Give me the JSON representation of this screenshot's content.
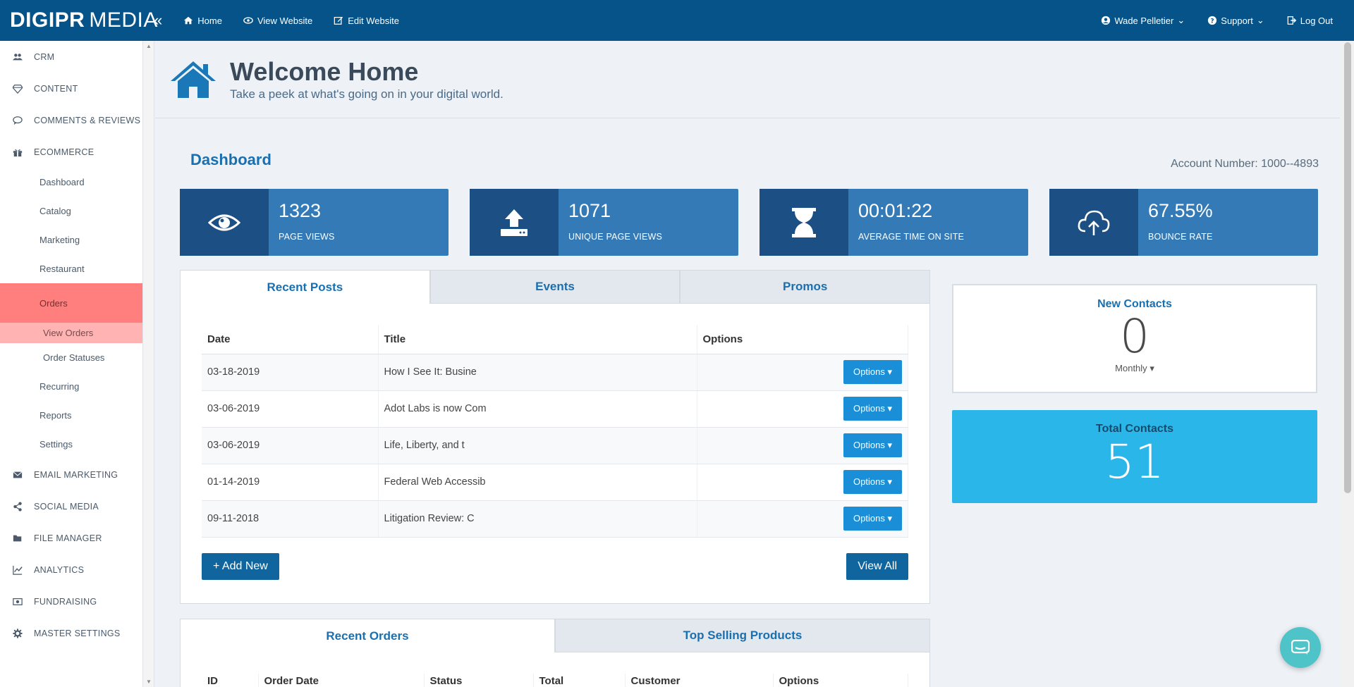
{
  "brand": {
    "part1": "DIGIPR",
    "part2": "MEDIA"
  },
  "topnav": [
    {
      "label": "Home"
    },
    {
      "label": "View Website"
    },
    {
      "label": "Edit Website"
    }
  ],
  "topright": {
    "user": "Wade Pelletier",
    "support": "Support",
    "logout": "Log Out"
  },
  "sidebar": {
    "crm": "CRM",
    "content": "CONTENT",
    "comments": "COMMENTS & REVIEWS",
    "ecommerce": "ECOMMERCE",
    "ecom_sub": [
      "Dashboard",
      "Catalog",
      "Marketing",
      "Restaurant"
    ],
    "orders": "Orders",
    "view_orders": "View Orders",
    "order_statuses": "Order Statuses",
    "ecom_sub2": [
      "Recurring",
      "Reports",
      "Settings"
    ],
    "email": "EMAIL MARKETING",
    "social": "SOCIAL MEDIA",
    "files": "FILE MANAGER",
    "analytics": "ANALYTICS",
    "fundraising": "FUNDRAISING",
    "master": "MASTER SETTINGS"
  },
  "hero": {
    "title": "Welcome Home",
    "subtitle": "Take a peek at what's going on in your digital world."
  },
  "dashboard": {
    "title": "Dashboard",
    "account": "Account Number: 1000--4893"
  },
  "stats": [
    {
      "value": "1323",
      "label": "PAGE VIEWS"
    },
    {
      "value": "1071",
      "label": "UNIQUE PAGE VIEWS"
    },
    {
      "value": "00:01:22",
      "label": "AVERAGE TIME ON SITE"
    },
    {
      "value": "67.55%",
      "label": "BOUNCE RATE"
    }
  ],
  "posts": {
    "tabs": [
      "Recent Posts",
      "Events",
      "Promos"
    ],
    "headers": [
      "Date",
      "Title",
      "Options"
    ],
    "rows": [
      {
        "date": "03-18-2019",
        "title": "How I See It: Busine"
      },
      {
        "date": "03-06-2019",
        "title": "Adot Labs is now Com"
      },
      {
        "date": "03-06-2019",
        "title": "Life, Liberty, and t"
      },
      {
        "date": "01-14-2019",
        "title": "Federal Web Accessib"
      },
      {
        "date": "09-11-2018",
        "title": "Litigation Review: C"
      }
    ],
    "options_label": "Options",
    "add_new": "+ Add New",
    "view_all": "View All"
  },
  "contacts": {
    "new_title": "New Contacts",
    "new_value": "0",
    "period": "Monthly",
    "total_title": "Total Contacts",
    "total_value": "51"
  },
  "orders": {
    "tabs": [
      "Recent Orders",
      "Top Selling Products"
    ],
    "headers": [
      "ID",
      "Order Date",
      "Status",
      "Total",
      "Customer",
      "Options"
    ]
  }
}
